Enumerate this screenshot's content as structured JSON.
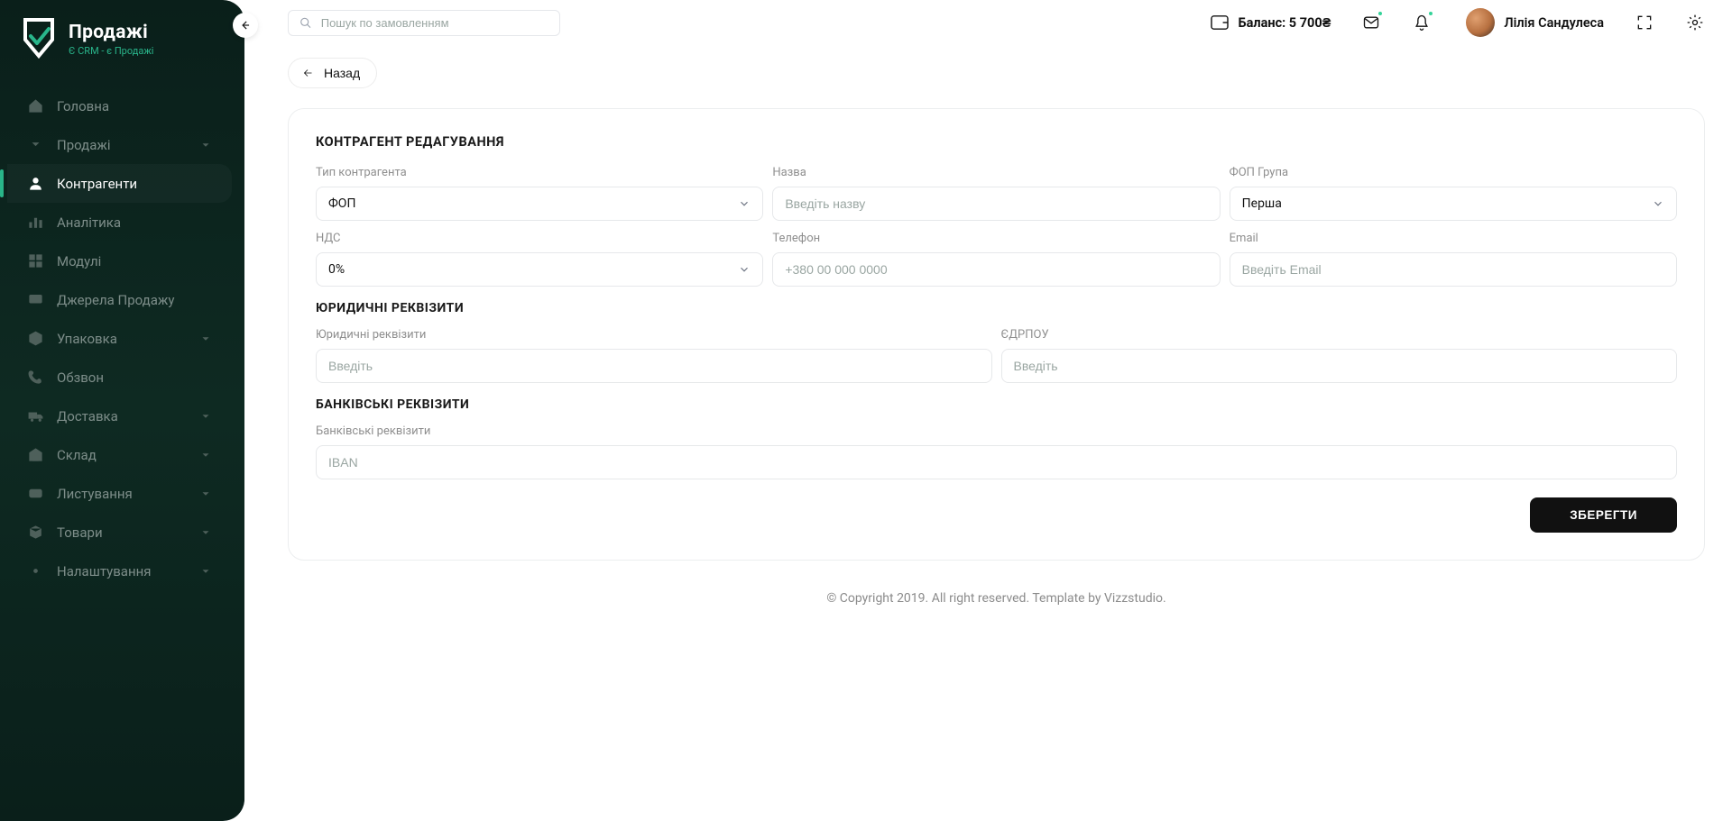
{
  "brand": {
    "title": "Продажі",
    "subtitle": "Є CRM - є Продажі"
  },
  "sidebar": {
    "items": [
      {
        "label": "Головна",
        "icon": "home",
        "expandable": false
      },
      {
        "label": "Продажі",
        "icon": "sale",
        "expandable": true
      },
      {
        "label": "Контрагенти",
        "icon": "person",
        "expandable": false,
        "active": true
      },
      {
        "label": "Аналітика",
        "icon": "chart",
        "expandable": false
      },
      {
        "label": "Модулі",
        "icon": "modules",
        "expandable": false
      },
      {
        "label": "Джерела Продажу",
        "icon": "source",
        "expandable": false
      },
      {
        "label": "Упаковка",
        "icon": "box",
        "expandable": true
      },
      {
        "label": "Обзвон",
        "icon": "phone",
        "expandable": false
      },
      {
        "label": "Доставка",
        "icon": "delivery",
        "expandable": true
      },
      {
        "label": "Склад",
        "icon": "warehouse",
        "expandable": true
      },
      {
        "label": "Листування",
        "icon": "mail",
        "expandable": true
      },
      {
        "label": "Товари",
        "icon": "goods",
        "expandable": true
      },
      {
        "label": "Налаштування",
        "icon": "settings",
        "expandable": true
      }
    ]
  },
  "top": {
    "search_placeholder": "Пошук по замовленням",
    "balance_label": "Баланс: 5 700₴",
    "user_name": "Лілія Сандулеса"
  },
  "page": {
    "back_label": "Назад",
    "title": "КОНТРАГЕНТ РЕДАГУВАННЯ",
    "field_labels": {
      "type": "Тип контрагента",
      "name": "Назва",
      "group": "ФОП Група",
      "vat": "НДС",
      "phone": "Телефон",
      "email": "Email",
      "legal_header": "ЮРИДИЧНІ РЕКВІЗИТИ",
      "legal": "Юридичні реквізити",
      "edrpou": "ЄДРПОУ",
      "bank_header": "БАНКІВСЬКІ РЕКВІЗИТИ",
      "bank": "Банківські реквізити"
    },
    "values": {
      "type": "ФОП",
      "group": "Перша",
      "vat": "0%"
    },
    "placeholders": {
      "name": "Введіть назву",
      "phone": "+380 00 000 0000",
      "email": "Введіть Email",
      "legal": "Введіть",
      "edrpou": "Введіть",
      "bank": "IBAN"
    },
    "save_label": "ЗБЕРЕГТИ"
  },
  "footer": "© Copyright 2019. All right reserved. Template by Vizzstudio."
}
